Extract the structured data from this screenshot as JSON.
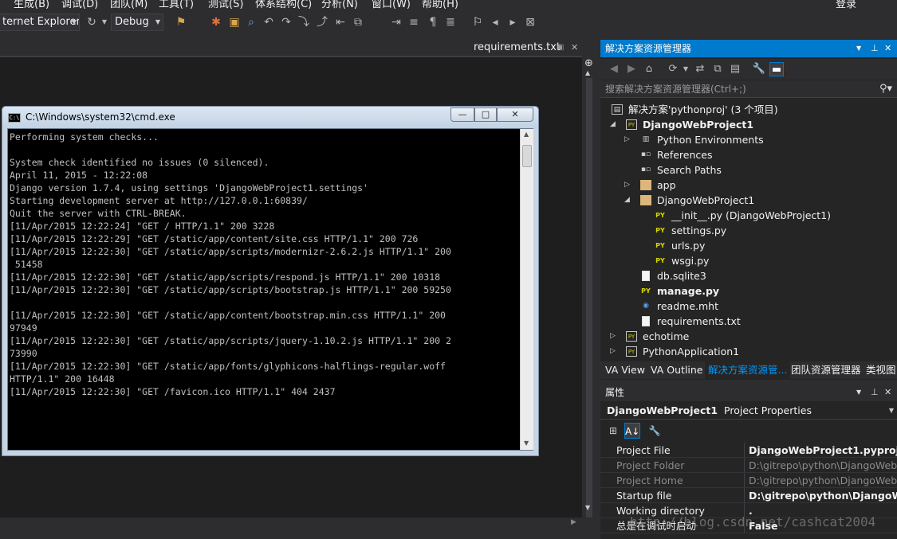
{
  "menubar": {
    "items": [
      "生成(B)",
      "调试(D)",
      "团队(M)",
      "工具(T)",
      "测试(S)",
      "体系结构(C)",
      "分析(N)",
      "窗口(W)",
      "帮助(H)"
    ],
    "signin": "登录"
  },
  "toolbar": {
    "browser_combo": "ternet Explorer",
    "config_combo": "Debug"
  },
  "editor": {
    "tab_label": "requirements.txt"
  },
  "cmd": {
    "title": "C:\\Windows\\system32\\cmd.exe",
    "icon_text": "C:\\",
    "minimize_label": "—",
    "maximize_label": "□",
    "close_label": "✕",
    "lines": [
      "Performing system checks...",
      "",
      "System check identified no issues (0 silenced).",
      "April 11, 2015 - 12:22:08",
      "Django version 1.7.4, using settings 'DjangoWebProject1.settings'",
      "Starting development server at http://127.0.0.1:60839/",
      "Quit the server with CTRL-BREAK.",
      "[11/Apr/2015 12:22:24] \"GET / HTTP/1.1\" 200 3228",
      "[11/Apr/2015 12:22:29] \"GET /static/app/content/site.css HTTP/1.1\" 200 726",
      "[11/Apr/2015 12:22:30] \"GET /static/app/scripts/modernizr-2.6.2.js HTTP/1.1\" 200",
      " 51458",
      "[11/Apr/2015 12:22:30] \"GET /static/app/scripts/respond.js HTTP/1.1\" 200 10318",
      "[11/Apr/2015 12:22:30] \"GET /static/app/scripts/bootstrap.js HTTP/1.1\" 200 59250",
      "",
      "[11/Apr/2015 12:22:30] \"GET /static/app/content/bootstrap.min.css HTTP/1.1\" 200",
      "97949",
      "[11/Apr/2015 12:22:30] \"GET /static/app/scripts/jquery-1.10.2.js HTTP/1.1\" 200 2",
      "73990",
      "[11/Apr/2015 12:22:30] \"GET /static/app/fonts/glyphicons-halflings-regular.woff",
      "HTTP/1.1\" 200 16448",
      "[11/Apr/2015 12:22:30] \"GET /favicon.ico HTTP/1.1\" 404 2437"
    ]
  },
  "solution_explorer": {
    "title": "解决方案资源管理器",
    "search_placeholder": "搜索解决方案资源管理器(Ctrl+;)",
    "items": [
      {
        "label": "解决方案'pythonproj' (3 个项目)",
        "icon": "solution-icon",
        "bold": false
      },
      {
        "label": "DjangoWebProject1",
        "icon": "python-project-icon",
        "bold": true
      },
      {
        "label": "Python Environments",
        "icon": "environments-icon",
        "bold": false
      },
      {
        "label": "References",
        "icon": "references-icon",
        "bold": false
      },
      {
        "label": "Search Paths",
        "icon": "search-paths-icon",
        "bold": false
      },
      {
        "label": "app",
        "icon": "folder-icon",
        "bold": false
      },
      {
        "label": "DjangoWebProject1",
        "icon": "folder-icon",
        "bold": false
      },
      {
        "label": "__init__.py (DjangoWebProject1)",
        "icon": "python-file-icon",
        "bold": false
      },
      {
        "label": "settings.py",
        "icon": "python-file-icon",
        "bold": false
      },
      {
        "label": "urls.py",
        "icon": "python-file-icon",
        "bold": false
      },
      {
        "label": "wsgi.py",
        "icon": "python-file-icon",
        "bold": false
      },
      {
        "label": "db.sqlite3",
        "icon": "file-icon",
        "bold": false
      },
      {
        "label": "manage.py",
        "icon": "python-file-icon",
        "bold": true
      },
      {
        "label": "readme.mht",
        "icon": "web-file-icon",
        "bold": false
      },
      {
        "label": "requirements.txt",
        "icon": "file-icon",
        "bold": false
      },
      {
        "label": "echotime",
        "icon": "python-project-icon",
        "bold": false
      },
      {
        "label": "PythonApplication1",
        "icon": "python-project-icon",
        "bold": false
      }
    ]
  },
  "bottom_tabs": [
    "VA View",
    "VA Outline",
    "解决方案资源管...",
    "团队资源管理器",
    "类视图"
  ],
  "properties": {
    "title": "属性",
    "object_name": "DjangoWebProject1",
    "object_type": "Project Properties",
    "rows": [
      {
        "name": "Project File",
        "value": "DjangoWebProject1.pyproj"
      },
      {
        "name": "Project Folder",
        "value": "D:\\gitrepo\\python\\DjangoWebP"
      },
      {
        "name": "Project Home",
        "value": "D:\\gitrepo\\python\\DjangoWebP"
      },
      {
        "name": "Startup file",
        "value": "D:\\gitrepo\\python\\DjangoWe"
      },
      {
        "name": "Working directory",
        "value": "."
      },
      {
        "name": "总是在调试时启动",
        "value": "False"
      }
    ]
  },
  "watermark": "http://blog.csdn.net/cashcat2004"
}
